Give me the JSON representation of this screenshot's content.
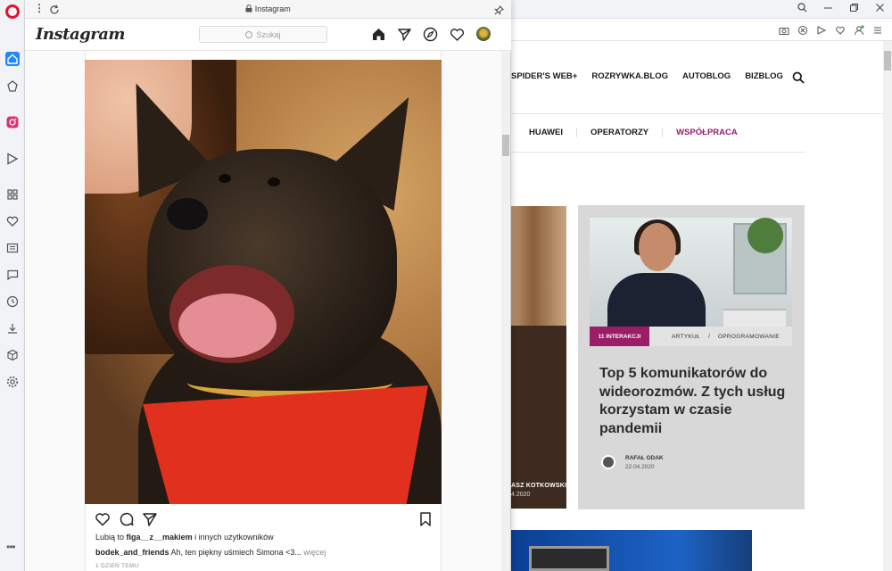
{
  "colors": {
    "opera_red": "#e8112d",
    "accent_blue": "#1f87ff",
    "collab_purple": "#9d1a6a",
    "interactions_badge": "#9a1d66"
  },
  "sidebar": {
    "icons": [
      "opera-logo",
      "home-icon",
      "pinboard-icon",
      "instagram-icon",
      "send-icon",
      "apps-icon",
      "heart-icon",
      "news-icon",
      "chat-icon",
      "history-icon",
      "download-icon",
      "cube-icon",
      "settings-icon"
    ],
    "more": "•••"
  },
  "instagram": {
    "url": "Instagram",
    "logo": "Instagram",
    "search_placeholder": "Szukaj",
    "likes_prefix": "Lubią to ",
    "likes_user": "figa__z__makiem",
    "likes_suffix": " i innych użytkowników",
    "caption_user": "bodek_and_friends",
    "caption_text": " Ah, ten piękny uśmiech Simona <3...",
    "caption_more": " więcej",
    "time_ago": "1 DZIEŃ TEMU"
  },
  "website": {
    "nav_top": [
      "SPIDER'S WEB+",
      "ROZRYWKA.BLOG",
      "AUTOBLOG",
      "BIZBLOG"
    ],
    "nav_second": [
      "HUAWEI",
      "OPERATORZY",
      "WSPÓŁPRACA"
    ],
    "left_card": {
      "author": "ASZ KOTKOWSKI",
      "date": "4.2020"
    },
    "card": {
      "interactions": "11 INTERAKCJI",
      "tag1": "ARTYKUŁ",
      "slash": "/",
      "tag2": "OPROGRAMOWANIE",
      "title": "Top 5 komunikatorów do wideorozmów. Z tych usług korzystam w czasie pandemii",
      "author": "RAFAŁ GDAK",
      "date": "22.04.2020"
    }
  }
}
